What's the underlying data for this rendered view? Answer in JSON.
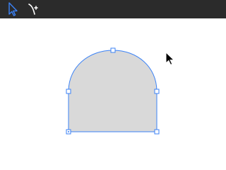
{
  "toolbar": {
    "tools": [
      {
        "name": "selection-tool",
        "icon": "arrow-pointer-icon",
        "active": true
      },
      {
        "name": "pen-tool",
        "icon": "pen-add-icon",
        "active": false
      }
    ]
  },
  "colors": {
    "toolbar_bg": "#2b2b2b",
    "shape_fill": "#d9d9d9",
    "selection_stroke": "#3b82f6",
    "active_tool": "#3b82f6",
    "inactive_tool": "#ffffff"
  },
  "canvas": {
    "shape": "rounded-arch",
    "selected": true
  }
}
